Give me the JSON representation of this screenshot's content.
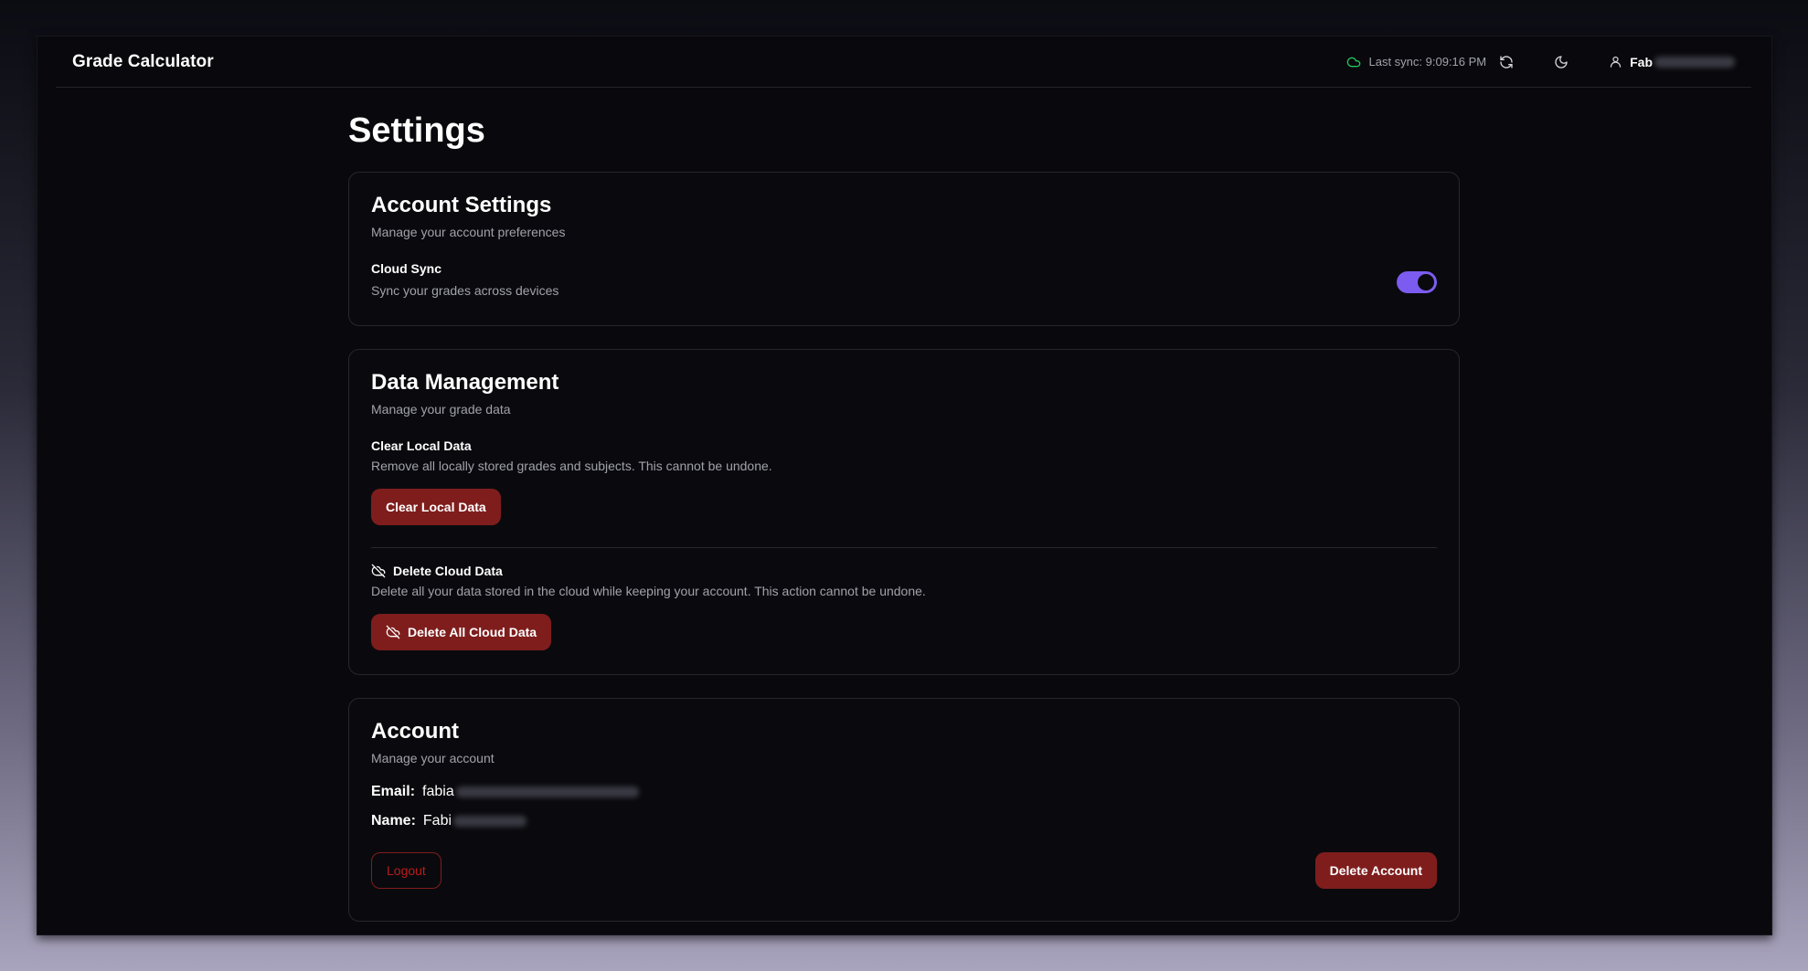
{
  "app": {
    "title": "Grade Calculator"
  },
  "header": {
    "sync_text": "Last sync: 9:09:16 PM",
    "user_name_visible": "Fab",
    "icons": [
      "cloud-icon",
      "refresh-icon",
      "moon-icon",
      "user-icon"
    ]
  },
  "page": {
    "title": "Settings"
  },
  "account_settings": {
    "title": "Account Settings",
    "description": "Manage your account preferences",
    "cloud_sync": {
      "label": "Cloud Sync",
      "description": "Sync your grades across devices",
      "enabled": true
    }
  },
  "data_management": {
    "title": "Data Management",
    "description": "Manage your grade data",
    "clear_local": {
      "label": "Clear Local Data",
      "description": "Remove all locally stored grades and subjects. This cannot be undone.",
      "button": "Clear Local Data"
    },
    "delete_cloud": {
      "label": "Delete Cloud Data",
      "description": "Delete all your data stored in the cloud while keeping your account. This action cannot be undone.",
      "button": "Delete All Cloud Data"
    }
  },
  "account": {
    "title": "Account",
    "description": "Manage your account",
    "email_label": "Email:",
    "email_visible": "fabia",
    "name_label": "Name:",
    "name_visible": "Fabi",
    "logout_button": "Logout",
    "delete_button": "Delete Account"
  },
  "colors": {
    "accent": "#7c5cf0",
    "danger": "#7f1d1d",
    "sync_ok": "#22c55e",
    "background": "#09090d"
  }
}
